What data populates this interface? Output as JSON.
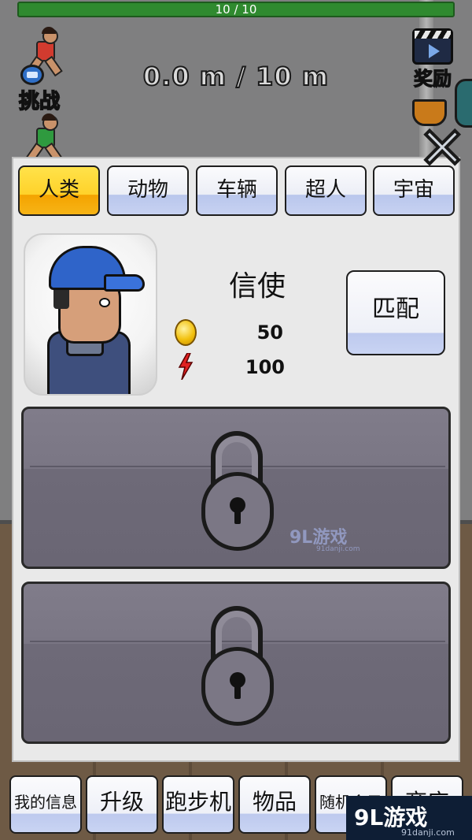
{
  "hud": {
    "hp_text": "10 / 10",
    "distance": "0.0 m / 10 m",
    "challenge_label": "挑战",
    "reward_label": "奖励"
  },
  "tabs": [
    {
      "label": "人类",
      "active": true
    },
    {
      "label": "动物",
      "active": false
    },
    {
      "label": "车辆",
      "active": false
    },
    {
      "label": "超人",
      "active": false
    },
    {
      "label": "宇宙",
      "active": false
    }
  ],
  "character": {
    "name": "信使",
    "coin_cost": "50",
    "energy_cost": "100"
  },
  "match_button": "匹配",
  "slots": [
    {
      "state": "locked"
    },
    {
      "state": "locked"
    }
  ],
  "watermark": {
    "text": "9L游戏",
    "url": "91danji.com"
  },
  "bottom_menu": [
    {
      "label": "我的信息"
    },
    {
      "label": "升级"
    },
    {
      "label": "跑步机"
    },
    {
      "label": "物品"
    },
    {
      "label": "随机盒子"
    },
    {
      "label": "商店"
    }
  ],
  "logo_badge": {
    "text": "9L游戏",
    "url": "91danji.com"
  },
  "colors": {
    "active_tab": "#ffd22a",
    "tab": "#eceef6",
    "panel": "#e9e9e9",
    "slot": "#7a7684",
    "hp_bar": "#2f8a2f"
  },
  "icons": [
    "runner-icon",
    "stopwatch-icon",
    "clapperboard-icon",
    "trophy-icon",
    "close-icon",
    "coin-icon",
    "energy-bolt-icon",
    "lock-icon"
  ]
}
